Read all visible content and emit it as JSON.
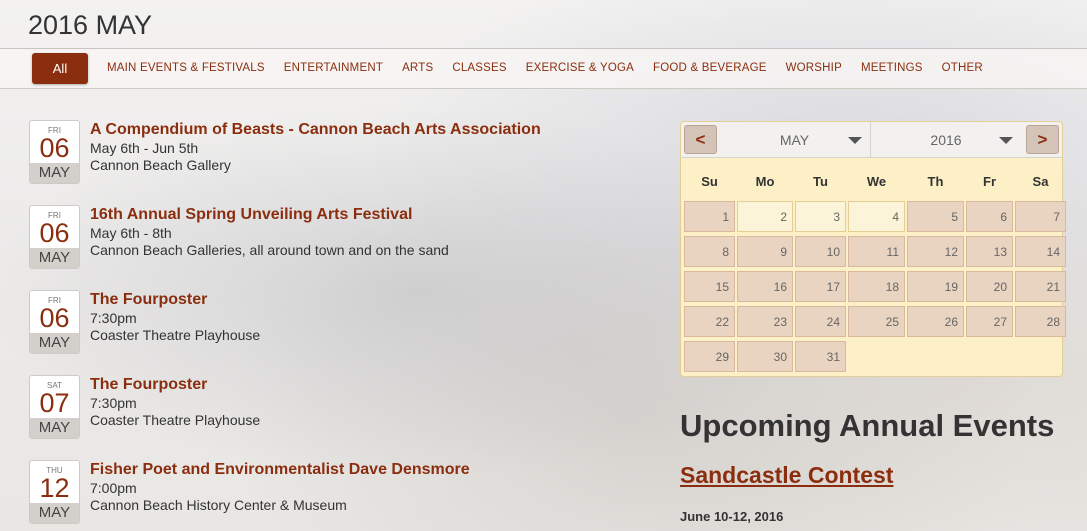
{
  "page_title": "2016 MAY",
  "filters": {
    "active": "All",
    "items": [
      "MAIN EVENTS & FESTIVALS",
      "ENTERTAINMENT",
      "ARTS",
      "CLASSES",
      "EXERCISE & YOGA",
      "FOOD & BEVERAGE",
      "WORSHIP",
      "MEETINGS",
      "OTHER"
    ]
  },
  "events": [
    {
      "dow": "FRI",
      "day": "06",
      "month": "MAY",
      "title": "A Compendium of Beasts - Cannon Beach Arts Association",
      "when": "May 6th - Jun 5th",
      "where": "Cannon Beach Gallery"
    },
    {
      "dow": "FRI",
      "day": "06",
      "month": "MAY",
      "title": "16th Annual Spring Unveiling Arts Festival",
      "when": "May 6th - 8th",
      "where": "Cannon Beach Galleries, all around town and on the sand"
    },
    {
      "dow": "FRI",
      "day": "06",
      "month": "MAY",
      "title": "The Fourposter",
      "when": "7:30pm",
      "where": "Coaster Theatre Playhouse"
    },
    {
      "dow": "SAT",
      "day": "07",
      "month": "MAY",
      "title": "The Fourposter",
      "when": "7:30pm",
      "where": "Coaster Theatre Playhouse"
    },
    {
      "dow": "THU",
      "day": "12",
      "month": "MAY",
      "title": "Fisher Poet and Environmentalist Dave Densmore",
      "when": "7:00pm",
      "where": "Cannon Beach History Center & Museum"
    }
  ],
  "calendar": {
    "prev": "<",
    "next": ">",
    "month": "MAY",
    "year": "2016",
    "weekdays": [
      "Su",
      "Mo",
      "Tu",
      "We",
      "Th",
      "Fr",
      "Sa"
    ],
    "weeks": [
      [
        "1",
        "2",
        "3",
        "4",
        "5",
        "6",
        "7"
      ],
      [
        "8",
        "9",
        "10",
        "11",
        "12",
        "13",
        "14"
      ],
      [
        "15",
        "16",
        "17",
        "18",
        "19",
        "20",
        "21"
      ],
      [
        "22",
        "23",
        "24",
        "25",
        "26",
        "27",
        "28"
      ],
      [
        "29",
        "30",
        "31",
        "",
        "",
        "",
        ""
      ]
    ],
    "highlighted_days": [
      "2",
      "3",
      "4"
    ]
  },
  "upcoming": {
    "heading": "Upcoming Annual Events",
    "event_name": "Sandcastle Contest",
    "event_date": "June 10-12, 2016"
  },
  "colors": {
    "accent": "#8b2e0f",
    "calendar_bg": "#fdf0c6",
    "day_cell": "#e9d3c1"
  }
}
